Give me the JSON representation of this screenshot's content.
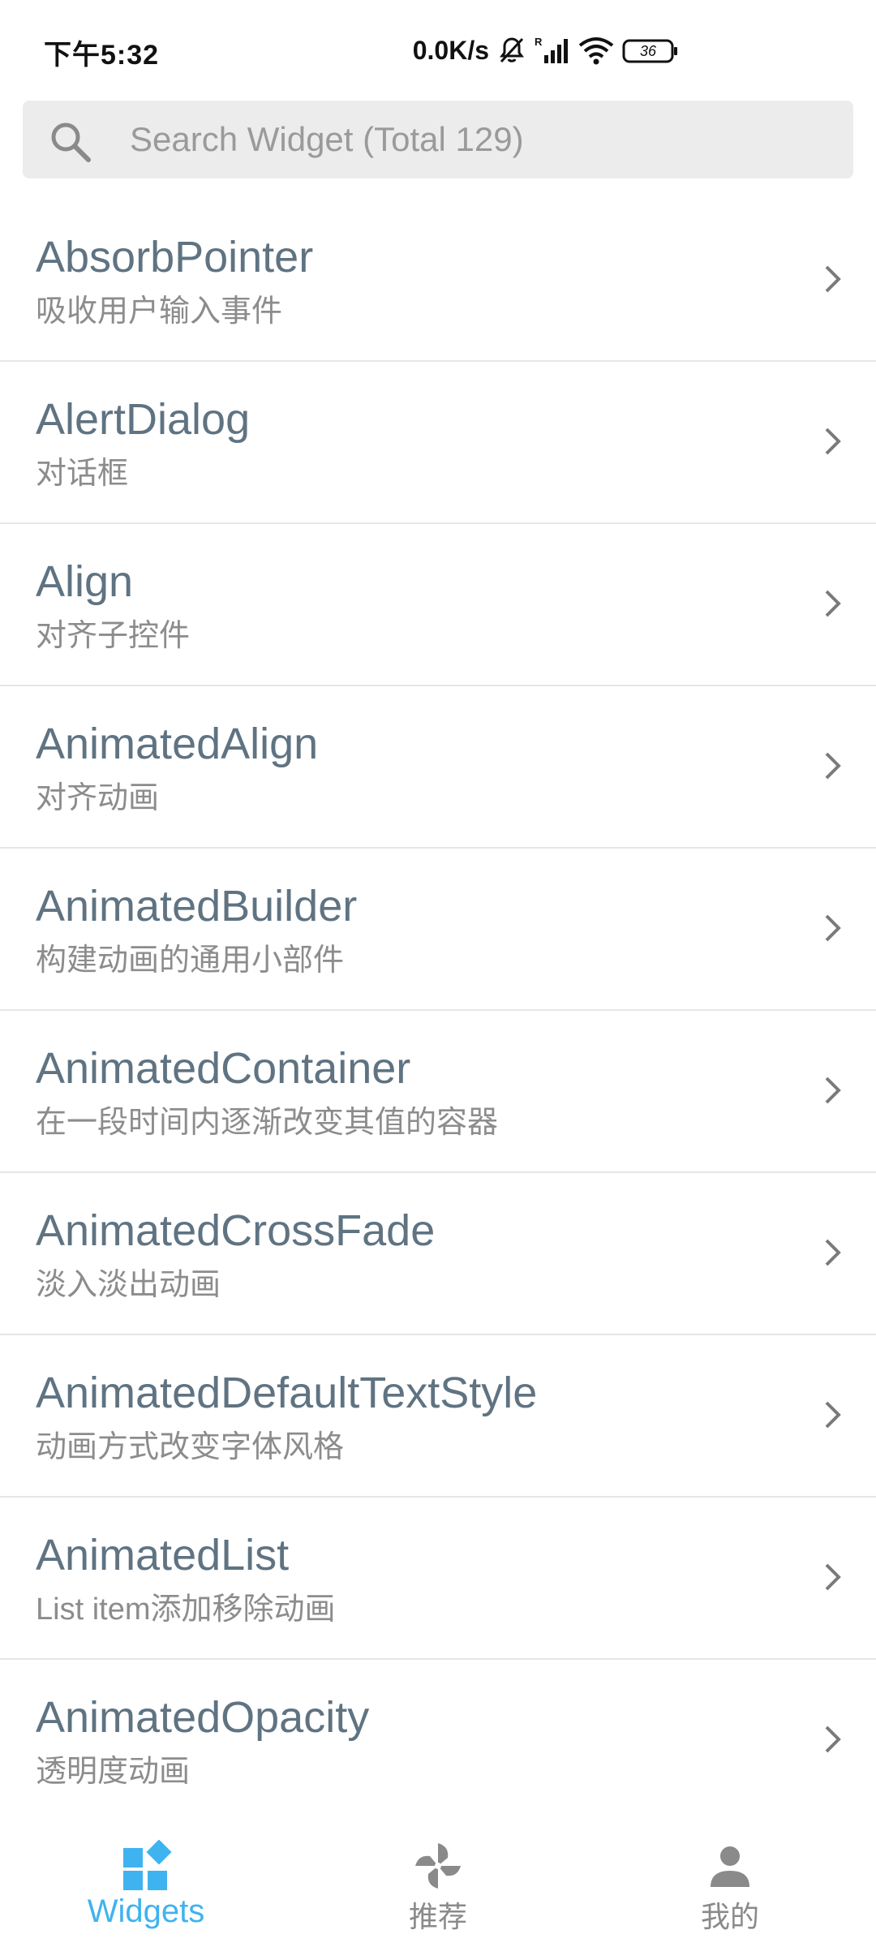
{
  "status_bar": {
    "time": "下午5:32",
    "network_speed": "0.0K/s",
    "battery": "36"
  },
  "search": {
    "placeholder": "Search Widget (Total 129)"
  },
  "widgets": [
    {
      "title": "AbsorbPointer",
      "subtitle": "吸收用户输入事件"
    },
    {
      "title": "AlertDialog",
      "subtitle": "对话框"
    },
    {
      "title": "Align",
      "subtitle": "对齐子控件"
    },
    {
      "title": "AnimatedAlign",
      "subtitle": "对齐动画"
    },
    {
      "title": "AnimatedBuilder",
      "subtitle": "构建动画的通用小部件"
    },
    {
      "title": "AnimatedContainer",
      "subtitle": "在一段时间内逐渐改变其值的容器"
    },
    {
      "title": "AnimatedCrossFade",
      "subtitle": "淡入淡出动画"
    },
    {
      "title": "AnimatedDefaultTextStyle",
      "subtitle": "动画方式改变字体风格"
    },
    {
      "title": "AnimatedList",
      "subtitle": "List item添加移除动画"
    },
    {
      "title": "AnimatedOpacity",
      "subtitle": "透明度动画"
    }
  ],
  "bottom_nav": {
    "items": [
      {
        "label": "Widgets",
        "icon": "widgets-icon",
        "active": true
      },
      {
        "label": "推荐",
        "icon": "pinwheel-icon",
        "active": false
      },
      {
        "label": "我的",
        "icon": "person-icon",
        "active": false
      }
    ]
  },
  "colors": {
    "accent": "#3fb3ef",
    "title_text": "#5f7382",
    "subtitle_text": "#8c8c8c",
    "search_bg": "#ececec"
  }
}
